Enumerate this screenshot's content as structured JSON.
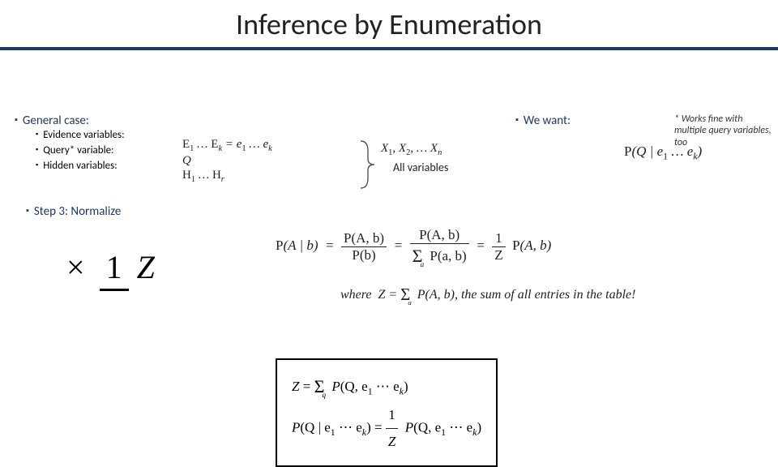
{
  "title": "Inference by Enumeration",
  "left": {
    "general_case": "General case:",
    "evidence": "Evidence variables:",
    "query": "Query* variable:",
    "hidden": "Hidden variables:",
    "step3": "Step 3: Normalize"
  },
  "right": {
    "we_want": "We want:"
  },
  "footnote": "* Works fine with multiple query variables, too",
  "all_vars_label": "All variables",
  "math": {
    "evidence": "E₁ … E_k = e₁ … e_k",
    "query": "Q",
    "hidden": "H₁ … H_r",
    "allvars": "X₁, X₂, … X_n",
    "wewant": "P(Q | e₁ … e_k)",
    "big_times": "×",
    "big_one": "1",
    "big_Z": "Z",
    "eq_main_lhs": "P(A | b) =",
    "eq_main_f1n": "P(A, b)",
    "eq_main_f1d": "P(b)",
    "eq_main_f2n": "P(A, b)",
    "eq_main_f2d": "Σ_a P(a, b)",
    "eq_main_rhs": "(1/Z) P(A, b)",
    "where_prefix": "where Z =",
    "where_sum": "Σ_a P(A, b)",
    "where_suffix": ", the sum of all entries in the table!",
    "box_line1_lhs": "Z =",
    "box_line1_rhs": "Σ_q P(Q, e₁ ⋯ e_k)",
    "box_line2_lhs": "P(Q | e₁ ⋯ e_k) =",
    "box_line2_rhs": "(1/Z) P(Q, e₁ ⋯ e_k)"
  }
}
